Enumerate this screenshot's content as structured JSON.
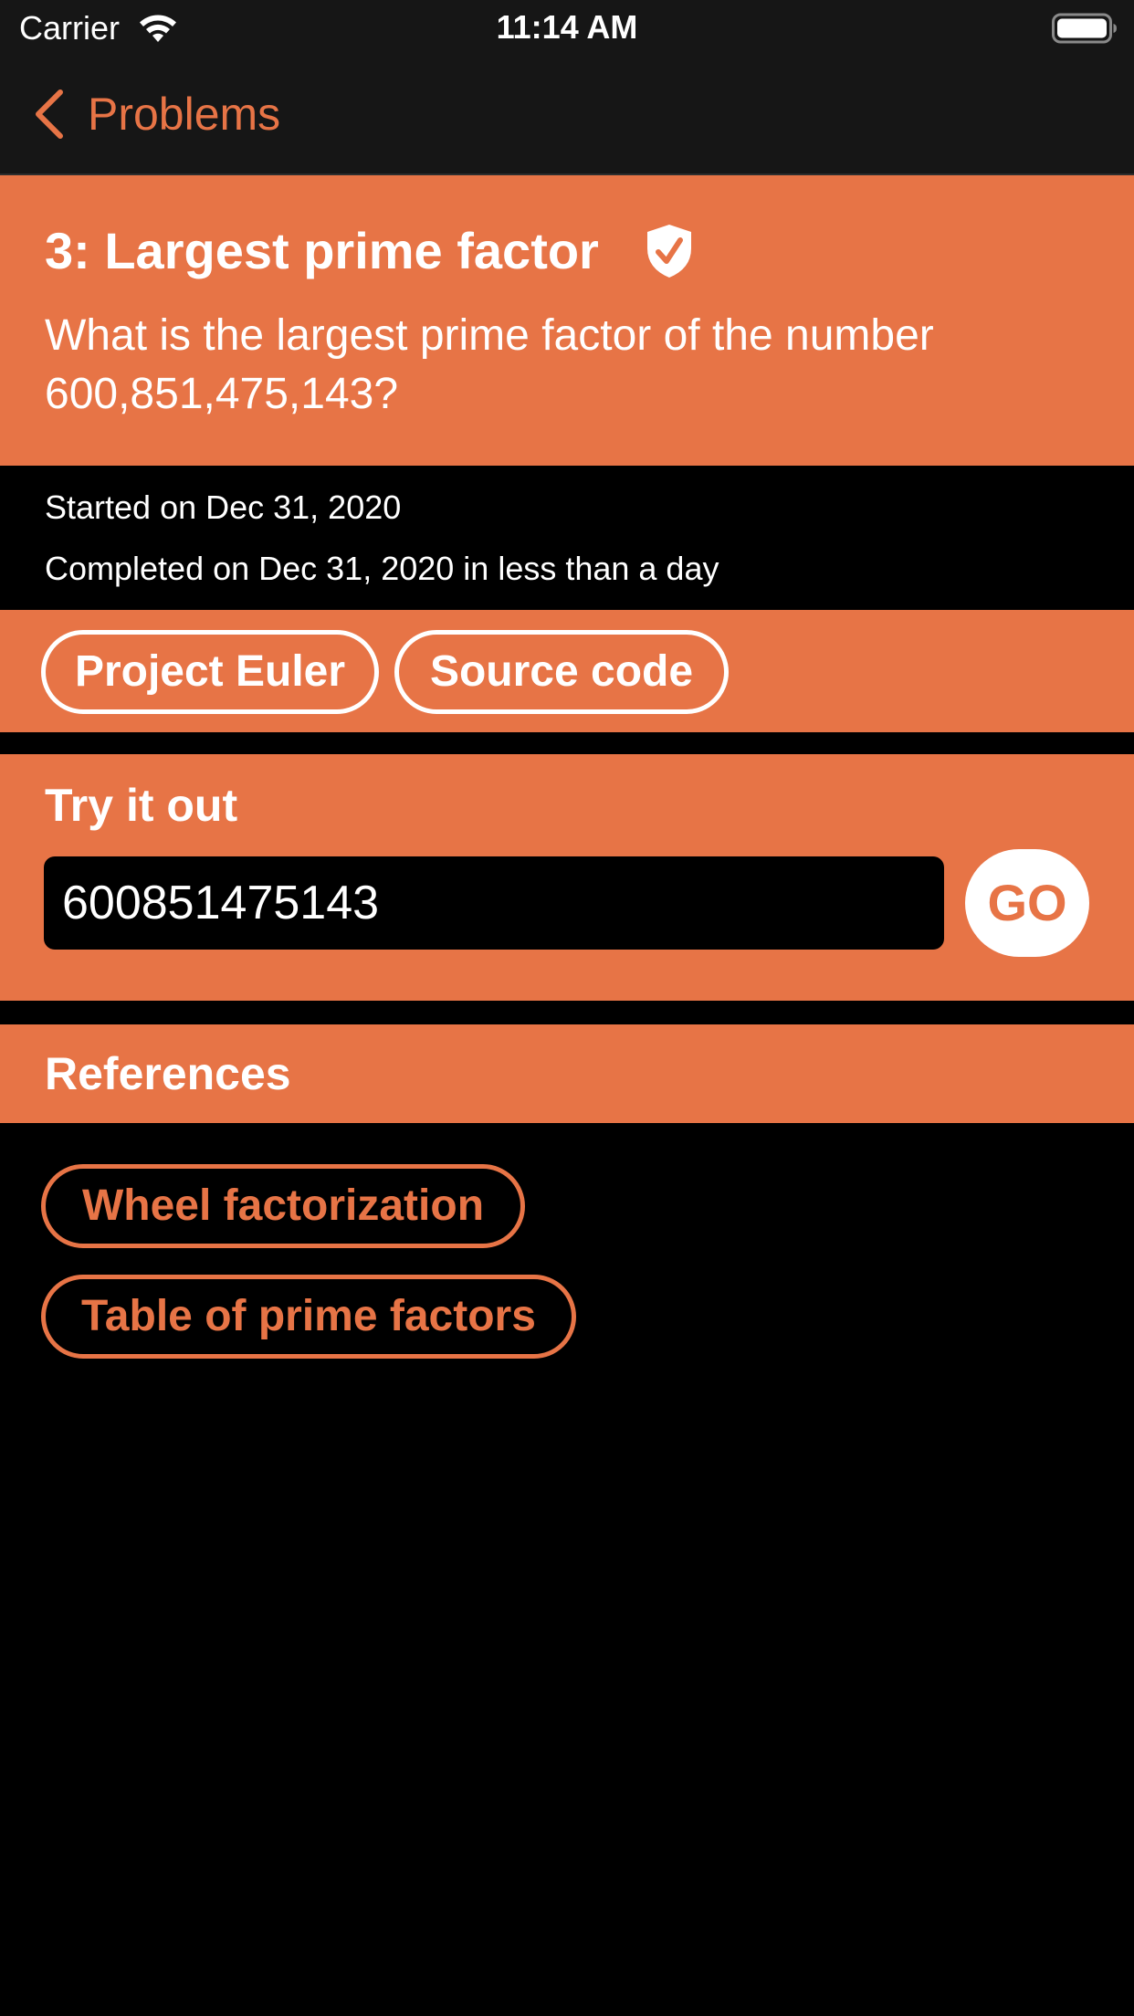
{
  "status_bar": {
    "carrier": "Carrier",
    "time": "11:14 AM",
    "wifi_icon": "wifi-icon",
    "battery_icon": "battery-icon"
  },
  "nav": {
    "back_label": "Problems",
    "back_icon": "chevron-left-icon"
  },
  "problem": {
    "title": "3: Largest prime factor",
    "solved_icon": "shield-check-icon",
    "description": "What is the largest prime factor of the number 600,851,475,143?",
    "started": "Started on Dec 31, 2020",
    "completed": "Completed on Dec 31, 2020 in less than a day"
  },
  "links": {
    "project_euler": "Project Euler",
    "source_code": "Source code"
  },
  "try_it": {
    "heading": "Try it out",
    "input_value": "600851475143",
    "go_label": "GO"
  },
  "references": {
    "title": "References",
    "items": [
      {
        "label": "Wheel factorization"
      },
      {
        "label": "Table of prime factors"
      }
    ]
  },
  "colors": {
    "accent": "#e77446",
    "bar_background": "#161616",
    "page_background": "#000000",
    "text": "#ffffff"
  }
}
